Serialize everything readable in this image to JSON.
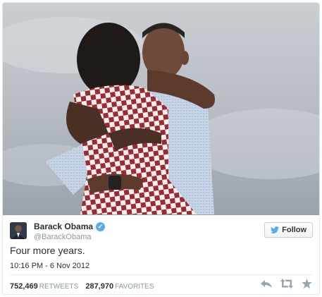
{
  "tweet": {
    "name": "Barack Obama",
    "handle": "@BarackObama",
    "text": "Four more years.",
    "timestamp": "10:16 PM - 6 Nov 2012",
    "retweets_count": "752,469",
    "retweets_label": "RETWEETS",
    "favorites_count": "287,970",
    "favorites_label": "FAVORITES"
  },
  "follow_button": {
    "label": "Follow"
  },
  "icons": {
    "verified": "verified-badge-icon",
    "follow": "twitter-bird-icon",
    "reply": "reply-icon",
    "retweet": "retweet-icon",
    "favorite": "star-icon"
  },
  "colors": {
    "accent": "#55acee",
    "text": "#292f33",
    "muted": "#8899a6"
  }
}
